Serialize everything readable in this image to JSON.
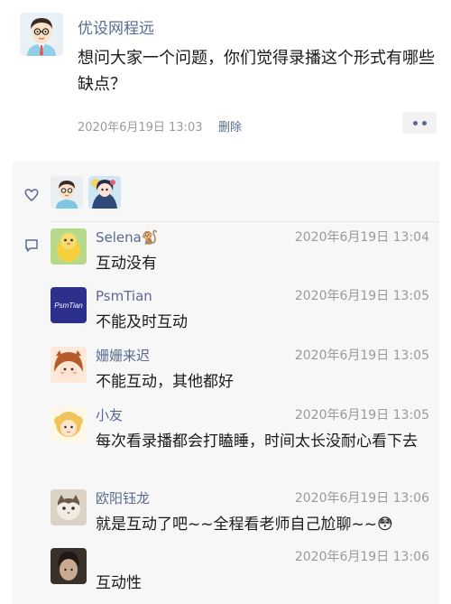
{
  "post": {
    "author": "优设网程远",
    "text": "想问大家一个问题，你们觉得录播这个形式有哪些缺点？",
    "time": "2020年6月19日 13:03",
    "delete_label": "删除"
  },
  "colors": {
    "link_blue": "#586b8f",
    "meta_gray": "#9a9a9a",
    "panel_bg": "#f7f7f7"
  },
  "likes": {
    "icon": "heart-icon",
    "avatars": [
      "avatar-man-glasses",
      "avatar-anime-girl"
    ]
  },
  "comments_icon": "comment-icon",
  "comments": [
    {
      "name": "Selena",
      "name_emoji": "🐒",
      "time": "2020年6月19日 13:04",
      "text": "互动没有"
    },
    {
      "name": "PsmTian",
      "avatar_text": "PsmTian",
      "time": "2020年6月19日 13:05",
      "text": "不能及时互动"
    },
    {
      "name": "姗姗来迟",
      "time": "2020年6月19日 13:05",
      "text": "不能互动，其他都好"
    },
    {
      "name": "小友",
      "time": "2020年6月19日 13:05",
      "text": "每次看录播都会打瞌睡，时间太长没耐心看下去"
    },
    {
      "name": "欧阳钰龙",
      "time": "2020年6月19日 13:06",
      "text": "就是互动了吧~~全程看老师自己尬聊~~😳"
    },
    {
      "name": "",
      "time": "2020年6月19日 13:06",
      "text": "互动性"
    }
  ]
}
